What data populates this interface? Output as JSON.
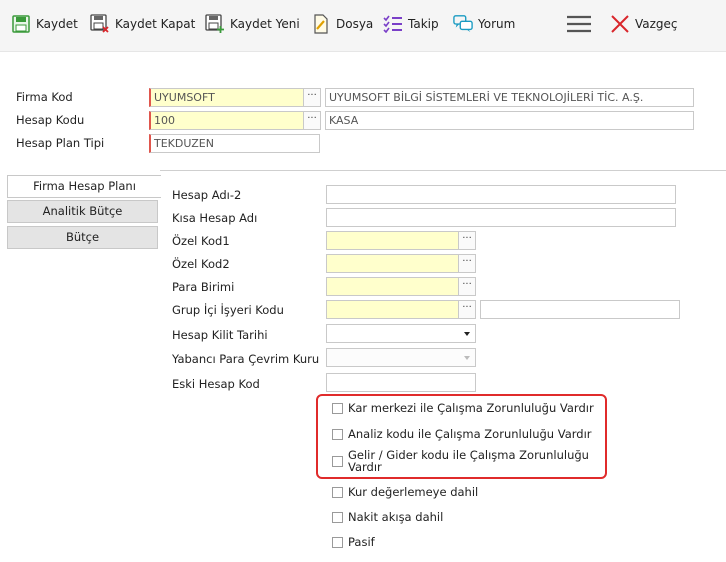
{
  "toolbar": {
    "save": "Kaydet",
    "save_close": "Kaydet Kapat",
    "save_new": "Kaydet Yeni",
    "file": "Dosya",
    "follow": "Takip",
    "comment": "Yorum",
    "cancel": "Vazgeç"
  },
  "header": {
    "firm_code_label": "Firma Kod",
    "firm_code_value": "UYUMSOFT",
    "firm_name_value": "UYUMSOFT BİLGİ SİSTEMLERİ VE TEKNOLOJİLERİ TİC. A.Ş.",
    "account_code_label": "Hesap Kodu",
    "account_code_value": "100",
    "account_name_value": "KASA",
    "plan_type_label": "Hesap Plan Tipi",
    "plan_type_value": "TEKDUZEN"
  },
  "tabs": [
    {
      "label": "Firma Hesap Planı",
      "active": true
    },
    {
      "label": "Analitik Bütçe",
      "active": false
    },
    {
      "label": "Bütçe",
      "active": false
    }
  ],
  "fields": {
    "account_name2": "Hesap Adı-2",
    "short_name": "Kısa Hesap Adı",
    "special_code1": "Özel Kod1",
    "special_code2": "Özel Kod2",
    "currency": "Para Birimi",
    "group_workplace": "Grup İçi İşyeri Kodu",
    "lock_date": "Hesap Kilit Tarihi",
    "fx_conversion_rate": "Yabancı Para Çevrim Kuru",
    "old_account_code": "Eski Hesap Kod"
  },
  "checkboxes": {
    "profit_center": "Kar merkezi ile Çalışma Zorunluluğu Vardır",
    "analysis_code": "Analiz kodu ile Çalışma Zorunluluğu Vardır",
    "income_expense_line1": "Gelir / Gider kodu ile Çalışma Zorunluluğu",
    "income_expense_line2": "Vardır",
    "fx_revaluation": "Kur değerlemeye dahil",
    "cash_flow": "Nakit akışa dahil",
    "passive": "Pasif"
  },
  "lookup_glyph": "···",
  "colors": {
    "required_yellow": "#ffffcc",
    "required_border": "#e0564d",
    "highlight": "#e02b2b",
    "save_icon": "#3a9a3a",
    "follow_icon": "#7a3fc8",
    "comment_icon": "#1a9bc2",
    "cancel_icon": "#d9262b"
  }
}
